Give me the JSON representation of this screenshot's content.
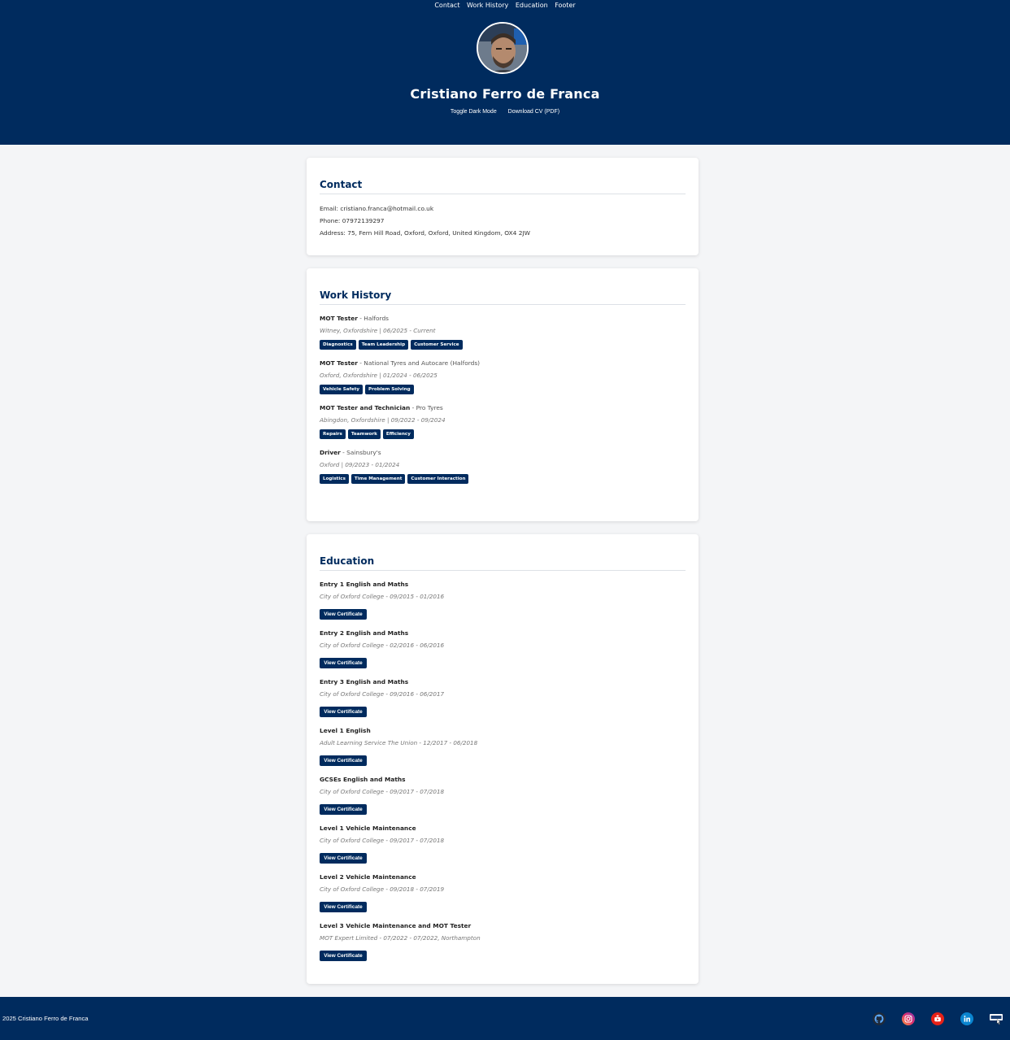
{
  "nav": [
    "Contact",
    "Work History",
    "Education",
    "Footer"
  ],
  "profile": {
    "name": "Cristiano Ferro de Franca",
    "toggle_label": "Toggle Dark Mode",
    "download_label": "Download CV (PDF)"
  },
  "contact": {
    "heading": "Contact",
    "email": "Email: cristiano.franca@hotmail.co.uk",
    "phone": "Phone: 07972139297",
    "address": "Address: 75, Fern Hill Road, Oxford, Oxford, United Kingdom, OX4 2JW"
  },
  "work": {
    "heading": "Work History",
    "jobs": [
      {
        "title": "MOT Tester",
        "company": " - Halfords",
        "meta": "Witney, Oxfordshire | 06/2025 - Current",
        "tags": [
          "Diagnostics",
          "Team Leadership",
          "Customer Service"
        ]
      },
      {
        "title": "MOT Tester",
        "company": " - National Tyres and Autocare (Halfords)",
        "meta": "Oxford, Oxfordshire | 01/2024 - 06/2025",
        "tags": [
          "Vehicle Safety",
          "Problem Solving"
        ]
      },
      {
        "title": "MOT Tester and Technician",
        "company": " - Pro Tyres",
        "meta": "Abingdon, Oxfordshire | 09/2022 - 09/2024",
        "tags": [
          "Repairs",
          "Teamwork",
          "Efficiency"
        ]
      },
      {
        "title": "Driver",
        "company": " - Sainsbury's",
        "meta": "Oxford | 09/2023 - 01/2024",
        "tags": [
          "Logistics",
          "Time Management",
          "Customer Interaction"
        ]
      }
    ]
  },
  "education": {
    "heading": "Education",
    "button_label": "View Certificate",
    "items": [
      {
        "title": "Entry 1 English and Maths",
        "meta": "City of Oxford College - 09/2015 - 01/2016"
      },
      {
        "title": "Entry 2 English and Maths",
        "meta": "City of Oxford College - 02/2016 - 06/2016"
      },
      {
        "title": "Entry 3 English and Maths",
        "meta": "City of Oxford College - 09/2016 - 06/2017"
      },
      {
        "title": "Level 1 English",
        "meta": "Adult Learning Service The Union - 12/2017 - 06/2018"
      },
      {
        "title": "GCSEs English and Maths",
        "meta": "City of Oxford College - 09/2017 - 07/2018"
      },
      {
        "title": "Level 1 Vehicle Maintenance",
        "meta": "City of Oxford College - 09/2017 - 07/2018"
      },
      {
        "title": "Level 2 Vehicle Maintenance",
        "meta": "City of Oxford College - 09/2018 - 07/2019"
      },
      {
        "title": "Level 3 Vehicle Maintenance and MOT Tester",
        "meta": "MOT Expert Limited - 07/2022 - 07/2022, Northampton"
      }
    ]
  },
  "footer": {
    "copyright": "2025 Cristiano Ferro de Franca",
    "icons": [
      "github-icon",
      "instagram-icon",
      "youtube-icon",
      "linkedin-icon",
      "indeed-icon"
    ]
  },
  "colors": {
    "primary": "#002b5e",
    "background": "#f4f5f7",
    "card": "#ffffff"
  }
}
